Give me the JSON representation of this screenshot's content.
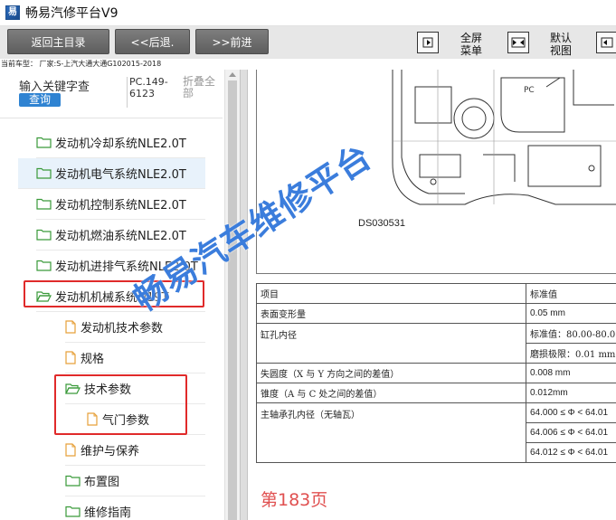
{
  "window": {
    "title": "畅易汽修平台V9",
    "icon_text": "易",
    "icon": "app-logo-icon"
  },
  "toolbar": {
    "home_label": "返回主目录",
    "back_label": "<<后退.",
    "forward_label": ">>前进",
    "fullscreen_label_1": "全屏",
    "fullscreen_label_2": "菜单",
    "default_view_label_1": "默认",
    "default_view_label_2": "视图"
  },
  "vehicle": {
    "text": "当前车型：  厂家:S-上汽大通大通G102015-2018"
  },
  "search": {
    "placeholder": "输入关键字查",
    "button_label": "查询",
    "pc_code": "PC.149-6123",
    "collapse_label": "折叠全部"
  },
  "tree": {
    "items": [
      {
        "label": "发动机冷却系统NLE2.0T",
        "type": "folder"
      },
      {
        "label": "发动机电气系统NLE2.0T",
        "type": "folder",
        "selected": true
      },
      {
        "label": "发动机控制系统NLE2.0T",
        "type": "folder"
      },
      {
        "label": "发动机燃油系统NLE2.0T",
        "type": "folder"
      },
      {
        "label": "发动机进排气系统NLE2.0T",
        "type": "folder"
      },
      {
        "label": "发动机机械系统D19T",
        "type": "folder",
        "open": true
      },
      {
        "label": "发动机技术参数",
        "type": "doc"
      },
      {
        "label": "规格",
        "type": "doc"
      },
      {
        "label": "技术参数",
        "type": "folder",
        "open": true
      },
      {
        "label": "气门参数",
        "type": "doc"
      },
      {
        "label": "维护与保养",
        "type": "doc"
      },
      {
        "label": "布置图",
        "type": "folder"
      },
      {
        "label": "维修指南",
        "type": "folder"
      }
    ]
  },
  "document": {
    "diagram_code": "DS030531",
    "table": {
      "header": [
        "项目",
        "标准值"
      ],
      "rows": [
        [
          "表面变形量",
          "0.05 mm"
        ],
        [
          "缸孔内径",
          "标准值：80.00-80.0"
        ],
        [
          "",
          "磨损极限：0.01 mm"
        ],
        [
          "失圆度（X 与 Y 方向之间的差值）",
          "0.008 mm"
        ],
        [
          "锥度（A 与 C 处之间的差值）",
          "0.012mm"
        ],
        [
          "主轴承孔内径（无轴瓦）",
          "64.000 ≤ Φ < 64.01"
        ],
        [
          "",
          "64.006 ≤ Φ < 64.01"
        ],
        [
          "",
          "64.012 ≤ Φ < 64.01"
        ]
      ]
    },
    "page_label": "第183页",
    "watermark": "畅易汽车维修平台"
  },
  "colors": {
    "accent": "#2f83d2",
    "highlight": "#e02a2a",
    "toolbar": "#e7e7e7",
    "folder": "#3a9a3a",
    "doc": "#e7a13a",
    "watermark": "#3b7ddc"
  }
}
